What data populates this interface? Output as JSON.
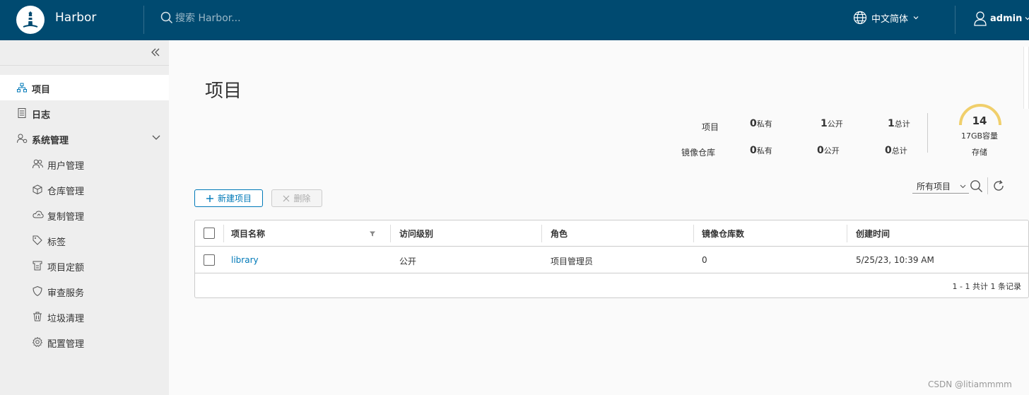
{
  "header": {
    "app_name": "Harbor",
    "search_placeholder": "搜索 Harbor...",
    "language": "中文简体",
    "user": "admin",
    "bg_color": "#004a70"
  },
  "sidebar": {
    "items": [
      {
        "label": "项目",
        "icon": "project-tree-icon",
        "active": true
      },
      {
        "label": "日志",
        "icon": "log-document-icon"
      },
      {
        "label": "系统管理",
        "icon": "system-admin-icon",
        "expanded": true
      },
      {
        "label": "用户管理",
        "icon": "users-icon"
      },
      {
        "label": "仓库管理",
        "icon": "box-icon"
      },
      {
        "label": "复制管理",
        "icon": "cloud-sync-icon"
      },
      {
        "label": "标签",
        "icon": "tag-icon"
      },
      {
        "label": "项目定额",
        "icon": "quota-icon"
      },
      {
        "label": "审查服务",
        "icon": "shield-icon"
      },
      {
        "label": "垃圾清理",
        "icon": "trash-icon"
      },
      {
        "label": "配置管理",
        "icon": "gear-icon"
      }
    ]
  },
  "main": {
    "title": "项目",
    "stats": {
      "projects_label": "项目",
      "repos_label": "镜像仓库",
      "projects": {
        "private": "0",
        "public": "1",
        "total": "1"
      },
      "repos": {
        "private": "0",
        "public": "0",
        "total": "0"
      },
      "private_unit": "私有",
      "public_unit": "公开",
      "total_unit": "总计"
    },
    "storage": {
      "number": "14",
      "capacity": "17GB容量",
      "label": "存储",
      "gauge_color": "#f0cf6b"
    },
    "buttons": {
      "new_project": "新建项目",
      "delete": "删除"
    },
    "filter": {
      "selected": "所有项目"
    },
    "table": {
      "columns": [
        "项目名称",
        "访问级别",
        "角色",
        "镜像仓库数",
        "创建时间"
      ],
      "rows": [
        {
          "name": "library",
          "access": "公开",
          "role": "项目管理员",
          "repo_count": "0",
          "created": "5/25/23, 10:39 AM"
        }
      ],
      "footer": "1 - 1 共计 1 条记录"
    }
  },
  "watermark": "CSDN @litiammmm"
}
